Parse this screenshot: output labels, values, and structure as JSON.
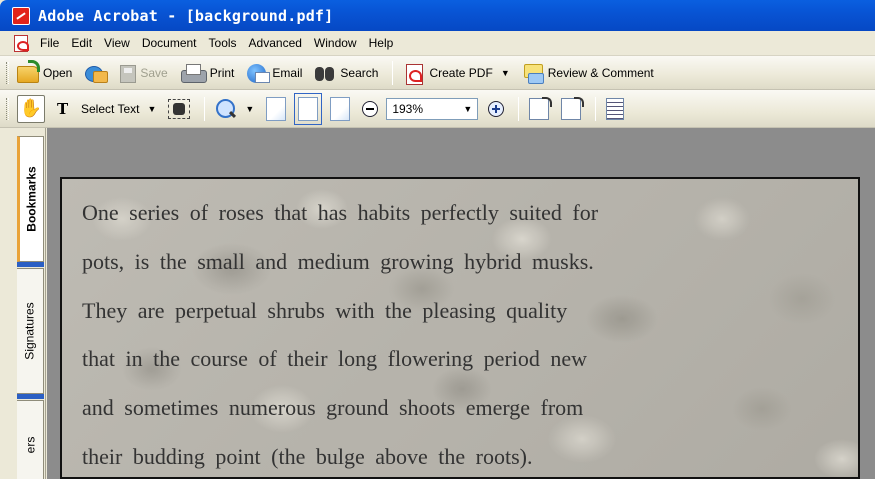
{
  "window": {
    "title": "Adobe Acrobat - [background.pdf]"
  },
  "menu": [
    "File",
    "Edit",
    "View",
    "Document",
    "Tools",
    "Advanced",
    "Window",
    "Help"
  ],
  "toolbar1": {
    "open": "Open",
    "save": "Save",
    "print": "Print",
    "email": "Email",
    "search": "Search",
    "create_pdf": "Create PDF",
    "review": "Review & Comment"
  },
  "toolbar2": {
    "select_text": "Select Text",
    "zoom_value": "193%"
  },
  "side_tabs": [
    "Bookmarks",
    "Signatures",
    "ers"
  ],
  "document": {
    "lines": [
      "One series of roses that has habits perfectly suited for",
      "pots, is the small and medium growing hybrid musks.",
      "They are perpetual shrubs with the pleasing quality",
      "that in the course of their long flowering period new",
      "and sometimes numerous ground shoots emerge from",
      "their budding point (the bulge above the roots)."
    ]
  },
  "icons": [
    "acrobat-icon",
    "pdf-icon",
    "open-icon",
    "organizer-icon",
    "save-icon",
    "print-icon",
    "email-icon",
    "search-icon",
    "create-pdf-icon",
    "review-icon",
    "hand-icon",
    "select-text-icon",
    "snapshot-icon",
    "zoom-in-icon",
    "zoom-out-icon",
    "rotate-icon",
    "list-icon"
  ]
}
